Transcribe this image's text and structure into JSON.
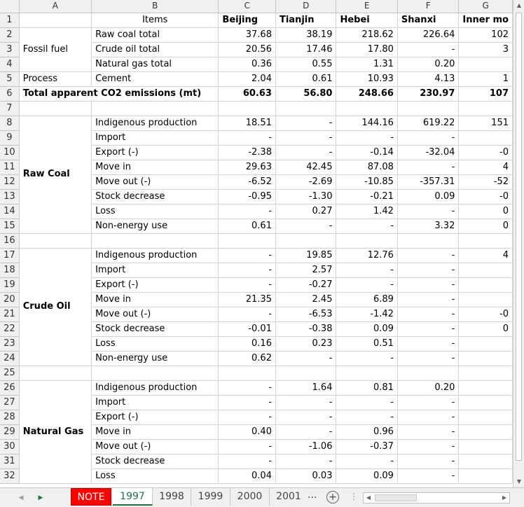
{
  "columns": [
    "A",
    "B",
    "C",
    "D",
    "E",
    "F",
    "G"
  ],
  "header_row": {
    "items": "Items",
    "beijing": "Beijing",
    "tianjin": "Tianjin",
    "hebei": "Hebei",
    "shanxi": "Shanxi",
    "inner": "Inner mo"
  },
  "rows": [
    {
      "n": "2",
      "a": "",
      "b": "Raw coal total",
      "c": "37.68",
      "d": "38.19",
      "e": "218.62",
      "f": "226.64",
      "g": "102"
    },
    {
      "n": "3",
      "a": "Fossil fuel",
      "b": "Crude oil total",
      "c": "20.56",
      "d": "17.46",
      "e": "17.80",
      "f": "-",
      "g": "3"
    },
    {
      "n": "4",
      "a": "",
      "b": "Natural gas total",
      "c": "0.36",
      "d": "0.55",
      "e": "1.31",
      "f": "0.20",
      "g": ""
    },
    {
      "n": "5",
      "a": "Process",
      "b": "Cement",
      "c": "2.04",
      "d": "0.61",
      "e": "10.93",
      "f": "4.13",
      "g": "1"
    },
    {
      "n": "6",
      "a": "Total apparent CO2 emissions (mt)",
      "b": "",
      "c": "60.63",
      "d": "56.80",
      "e": "248.66",
      "f": "230.97",
      "g": "107"
    },
    {
      "n": "7",
      "a": "",
      "b": "",
      "c": "",
      "d": "",
      "e": "",
      "f": "",
      "g": ""
    },
    {
      "n": "8",
      "a": "",
      "b": "Indigenous production",
      "c": "18.51",
      "d": "-",
      "e": "144.16",
      "f": "619.22",
      "g": "151"
    },
    {
      "n": "9",
      "a": "",
      "b": "Import",
      "c": "-",
      "d": "-",
      "e": "-",
      "f": "-",
      "g": ""
    },
    {
      "n": "10",
      "a": "",
      "b": "Export (-)",
      "c": "-2.38",
      "d": "-",
      "e": "-0.14",
      "f": "-32.04",
      "g": "-0"
    },
    {
      "n": "11",
      "a": "",
      "b": "Move in",
      "c": "29.63",
      "d": "42.45",
      "e": "87.08",
      "f": "-",
      "g": "4"
    },
    {
      "n": "12",
      "a": "",
      "b": "Move out (-)",
      "c": "-6.52",
      "d": "-2.69",
      "e": "-10.85",
      "f": "-357.31",
      "g": "-52"
    },
    {
      "n": "13",
      "a": "",
      "b": "Stock decrease",
      "c": "-0.95",
      "d": "-1.30",
      "e": "-0.21",
      "f": "0.09",
      "g": "-0"
    },
    {
      "n": "14",
      "a": "",
      "b": "Loss",
      "c": "-",
      "d": "0.27",
      "e": "1.42",
      "f": "-",
      "g": "0"
    },
    {
      "n": "15",
      "a": "",
      "b": "Non-energy use",
      "c": "0.61",
      "d": "-",
      "e": "-",
      "f": "3.32",
      "g": "0"
    },
    {
      "n": "16",
      "a": "",
      "b": "",
      "c": "",
      "d": "",
      "e": "",
      "f": "",
      "g": ""
    },
    {
      "n": "17",
      "a": "",
      "b": "Indigenous production",
      "c": "-",
      "d": "19.85",
      "e": "12.76",
      "f": "-",
      "g": "4"
    },
    {
      "n": "18",
      "a": "",
      "b": "Import",
      "c": "-",
      "d": "2.57",
      "e": "-",
      "f": "-",
      "g": ""
    },
    {
      "n": "19",
      "a": "",
      "b": "Export (-)",
      "c": "-",
      "d": "-0.27",
      "e": "-",
      "f": "-",
      "g": ""
    },
    {
      "n": "20",
      "a": "",
      "b": "Move in",
      "c": "21.35",
      "d": "2.45",
      "e": "6.89",
      "f": "-",
      "g": ""
    },
    {
      "n": "21",
      "a": "",
      "b": "Move out (-)",
      "c": "-",
      "d": "-6.53",
      "e": "-1.42",
      "f": "-",
      "g": "-0"
    },
    {
      "n": "22",
      "a": "",
      "b": "Stock decrease",
      "c": "-0.01",
      "d": "-0.38",
      "e": "0.09",
      "f": "-",
      "g": "0"
    },
    {
      "n": "23",
      "a": "",
      "b": "Loss",
      "c": "0.16",
      "d": "0.23",
      "e": "0.51",
      "f": "-",
      "g": ""
    },
    {
      "n": "24",
      "a": "",
      "b": "Non-energy use",
      "c": "0.62",
      "d": "-",
      "e": "-",
      "f": "-",
      "g": ""
    },
    {
      "n": "25",
      "a": "",
      "b": "",
      "c": "",
      "d": "",
      "e": "",
      "f": "",
      "g": ""
    },
    {
      "n": "26",
      "a": "",
      "b": "Indigenous production",
      "c": "-",
      "d": "1.64",
      "e": "0.81",
      "f": "0.20",
      "g": ""
    },
    {
      "n": "27",
      "a": "",
      "b": "Import",
      "c": "-",
      "d": "-",
      "e": "-",
      "f": "-",
      "g": ""
    },
    {
      "n": "28",
      "a": "",
      "b": "Export (-)",
      "c": "-",
      "d": "-",
      "e": "-",
      "f": "-",
      "g": ""
    },
    {
      "n": "29",
      "a": "",
      "b": "Move in",
      "c": "0.40",
      "d": "-",
      "e": "0.96",
      "f": "-",
      "g": ""
    },
    {
      "n": "30",
      "a": "",
      "b": "Move out (-)",
      "c": "-",
      "d": "-1.06",
      "e": "-0.37",
      "f": "-",
      "g": ""
    },
    {
      "n": "31",
      "a": "",
      "b": "Stock decrease",
      "c": "-",
      "d": "-",
      "e": "-",
      "f": "-",
      "g": ""
    },
    {
      "n": "32",
      "a": "",
      "b": "Loss",
      "c": "0.04",
      "d": "0.03",
      "e": "0.09",
      "f": "-",
      "g": ""
    }
  ],
  "groups": {
    "raw_coal": "Raw Coal",
    "crude_oil": "Crude Oil",
    "natural_gas": "Natural Gas"
  },
  "tabs": {
    "note": "NOTE",
    "t1997": "1997",
    "t1998": "1998",
    "t1999": "1999",
    "t2000": "2000",
    "t2001": "2001",
    "more": "...",
    "add": "+"
  },
  "colors": {
    "note_tab": "#ff0000",
    "active_tab_text": "#217346"
  }
}
